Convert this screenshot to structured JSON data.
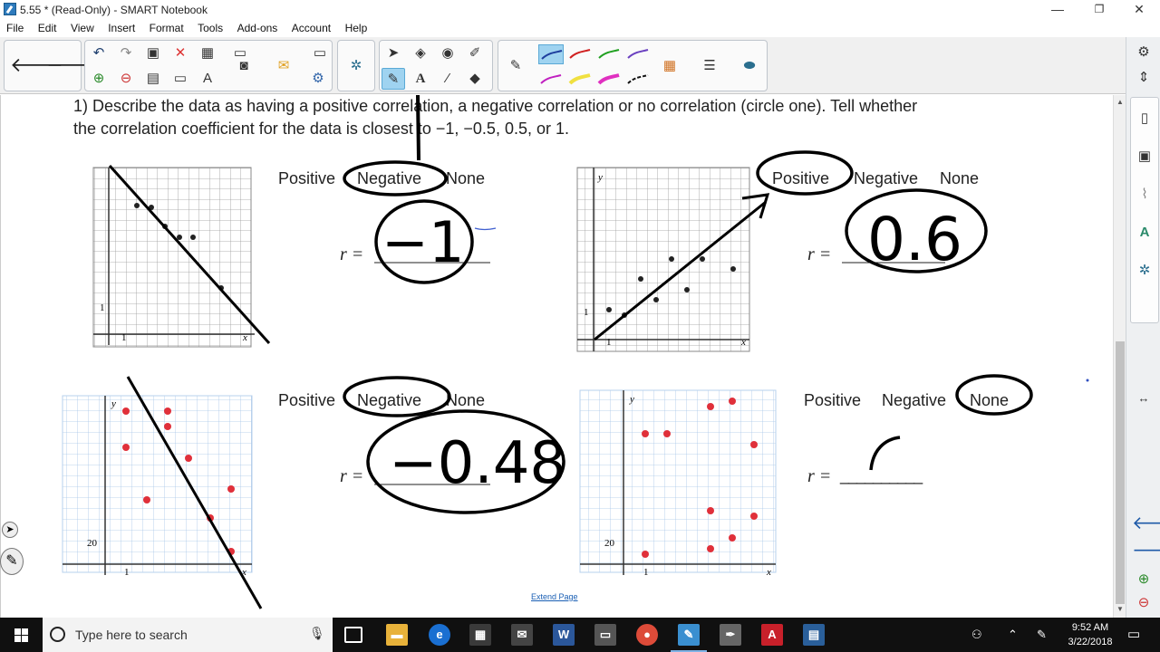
{
  "window": {
    "title": "5.55 * (Read-Only) - SMART Notebook",
    "minimize": "—",
    "restore": "❐",
    "close": "✕"
  },
  "menu": [
    "File",
    "Edit",
    "View",
    "Insert",
    "Format",
    "Tools",
    "Add-ons",
    "Account",
    "Help"
  ],
  "canvas": {
    "question_line1": "1)  Describe the data as having a positive correlation, a negative correlation or no correlation (circle one). Tell whether",
    "question_line2": "the correlation coefficient for the data is closest to −1, −0.5, 0.5, or 1.",
    "problems": [
      {
        "positive": "Positive",
        "negative": "Negative",
        "none": "None",
        "r_label": "r =",
        "answer": "−1"
      },
      {
        "positive": "Positive",
        "negative": "Negative",
        "none": "None",
        "r_label": "r =",
        "answer": "0.6"
      },
      {
        "positive": "Positive",
        "negative": "Negative",
        "none": "None",
        "r_label": "r =",
        "answer": "−0.48"
      },
      {
        "positive": "Positive",
        "negative": "Negative",
        "none": "None",
        "r_label": "r =",
        "blank": "__________"
      }
    ],
    "graph_labels": {
      "g1_y": "1",
      "g1_x": "1",
      "g1_xaxis": "x",
      "g2_y": "y",
      "g2_ytick": "1",
      "g2_xtick": "1",
      "g2_xaxis": "x",
      "g3_y": "y",
      "g3_ytick": "20",
      "g3_xtick": "1",
      "g3_xaxis": "x",
      "g4_y": "y",
      "g4_ytick": "20",
      "g4_xtick": "1",
      "g4_xaxis": "x"
    },
    "extend_page": "Extend Page"
  },
  "taskbar": {
    "search_placeholder": "Type here to search",
    "time": "9:52 AM",
    "date": "3/22/2018"
  },
  "colors": {
    "accent": "#9fd3f0",
    "red_dot": "#e0303a",
    "ink": "#000000"
  }
}
